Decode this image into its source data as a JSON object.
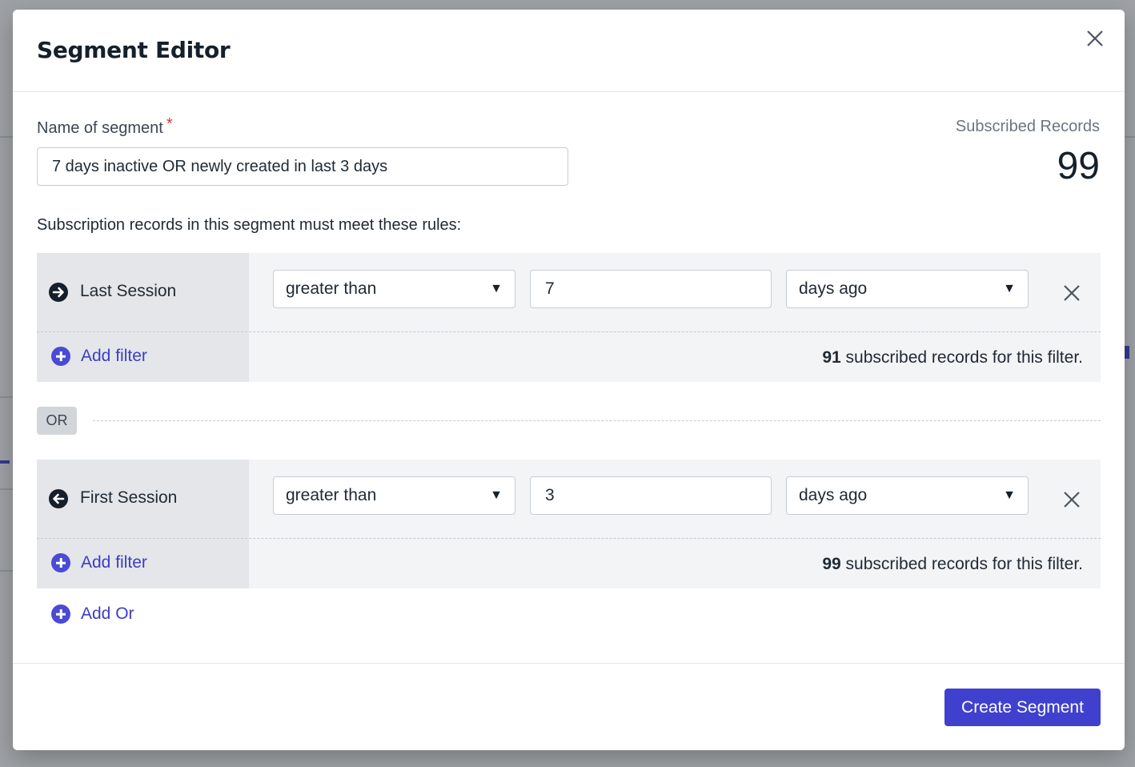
{
  "modal": {
    "title": "Segment Editor",
    "name_label": "Name of segment",
    "required_mark": "*",
    "name_value": "7 days inactive OR newly created in last 3 days",
    "subscribed_label": "Subscribed Records",
    "subscribed_count": "99",
    "rules_text": "Subscription records in this segment must meet these rules:",
    "or_label": "OR",
    "add_or_label": "Add Or",
    "create_button": "Create Segment"
  },
  "rules": [
    {
      "name": "Last Session",
      "icon": "arrow-right-circle-icon",
      "operator": "greater than",
      "value": "7",
      "unit": "days ago",
      "add_filter_label": "Add filter",
      "count": "91",
      "count_suffix": " subscribed records for this filter."
    },
    {
      "name": "First Session",
      "icon": "arrow-left-circle-icon",
      "operator": "greater than",
      "value": "3",
      "unit": "days ago",
      "add_filter_label": "Add filter",
      "count": "99",
      "count_suffix": " subscribed records for this filter."
    }
  ],
  "colors": {
    "accent": "#4040cf",
    "required": "#d63a3a"
  }
}
